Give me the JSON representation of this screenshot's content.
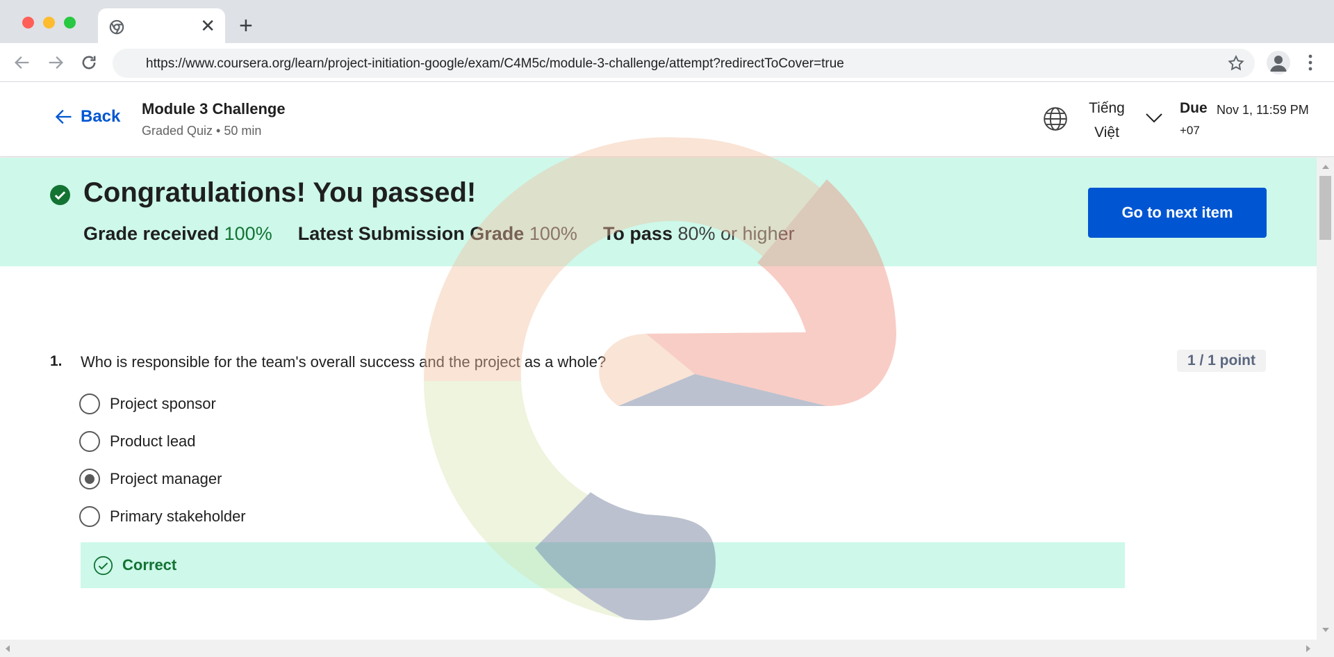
{
  "browser": {
    "url": "https://www.coursera.org/learn/project-initiation-google/exam/C4M5c/module-3-challenge/attempt?redirectToCover=true",
    "tab_close": "✕",
    "new_tab": "+"
  },
  "header": {
    "back_label": "Back",
    "module_title": "Module 3 Challenge",
    "module_subtitle": "Graded Quiz • 50 min",
    "language_line1": "Tiếng",
    "language_line2": "Việt",
    "due_label": "Due",
    "due_date": "Nov 1, 11:59 PM",
    "due_tz": "+07"
  },
  "banner": {
    "title": "Congratulations! You passed!",
    "grade_received_label": "Grade received",
    "grade_received_value": "100%",
    "latest_label": "Latest Submission Grade",
    "latest_value": "100%",
    "to_pass_label": "To pass",
    "to_pass_value": "80% or higher",
    "next_button": "Go to next item",
    "accent": "#cdf8ea",
    "button_color": "#0056d2"
  },
  "question": {
    "number": "1.",
    "text": "Who is responsible for the team's overall success and the project as a whole?",
    "points": "1 / 1 point",
    "options": [
      {
        "label": "Project sponsor",
        "selected": false
      },
      {
        "label": "Product lead",
        "selected": false
      },
      {
        "label": "Project manager",
        "selected": true
      },
      {
        "label": "Primary stakeholder",
        "selected": false
      }
    ],
    "feedback": "Correct"
  },
  "icons": {
    "back": "arrow-left-icon",
    "globe": "globe-icon",
    "chevron": "chevron-down-icon",
    "pass": "check-circle-icon",
    "correct": "check-outline-icon"
  }
}
